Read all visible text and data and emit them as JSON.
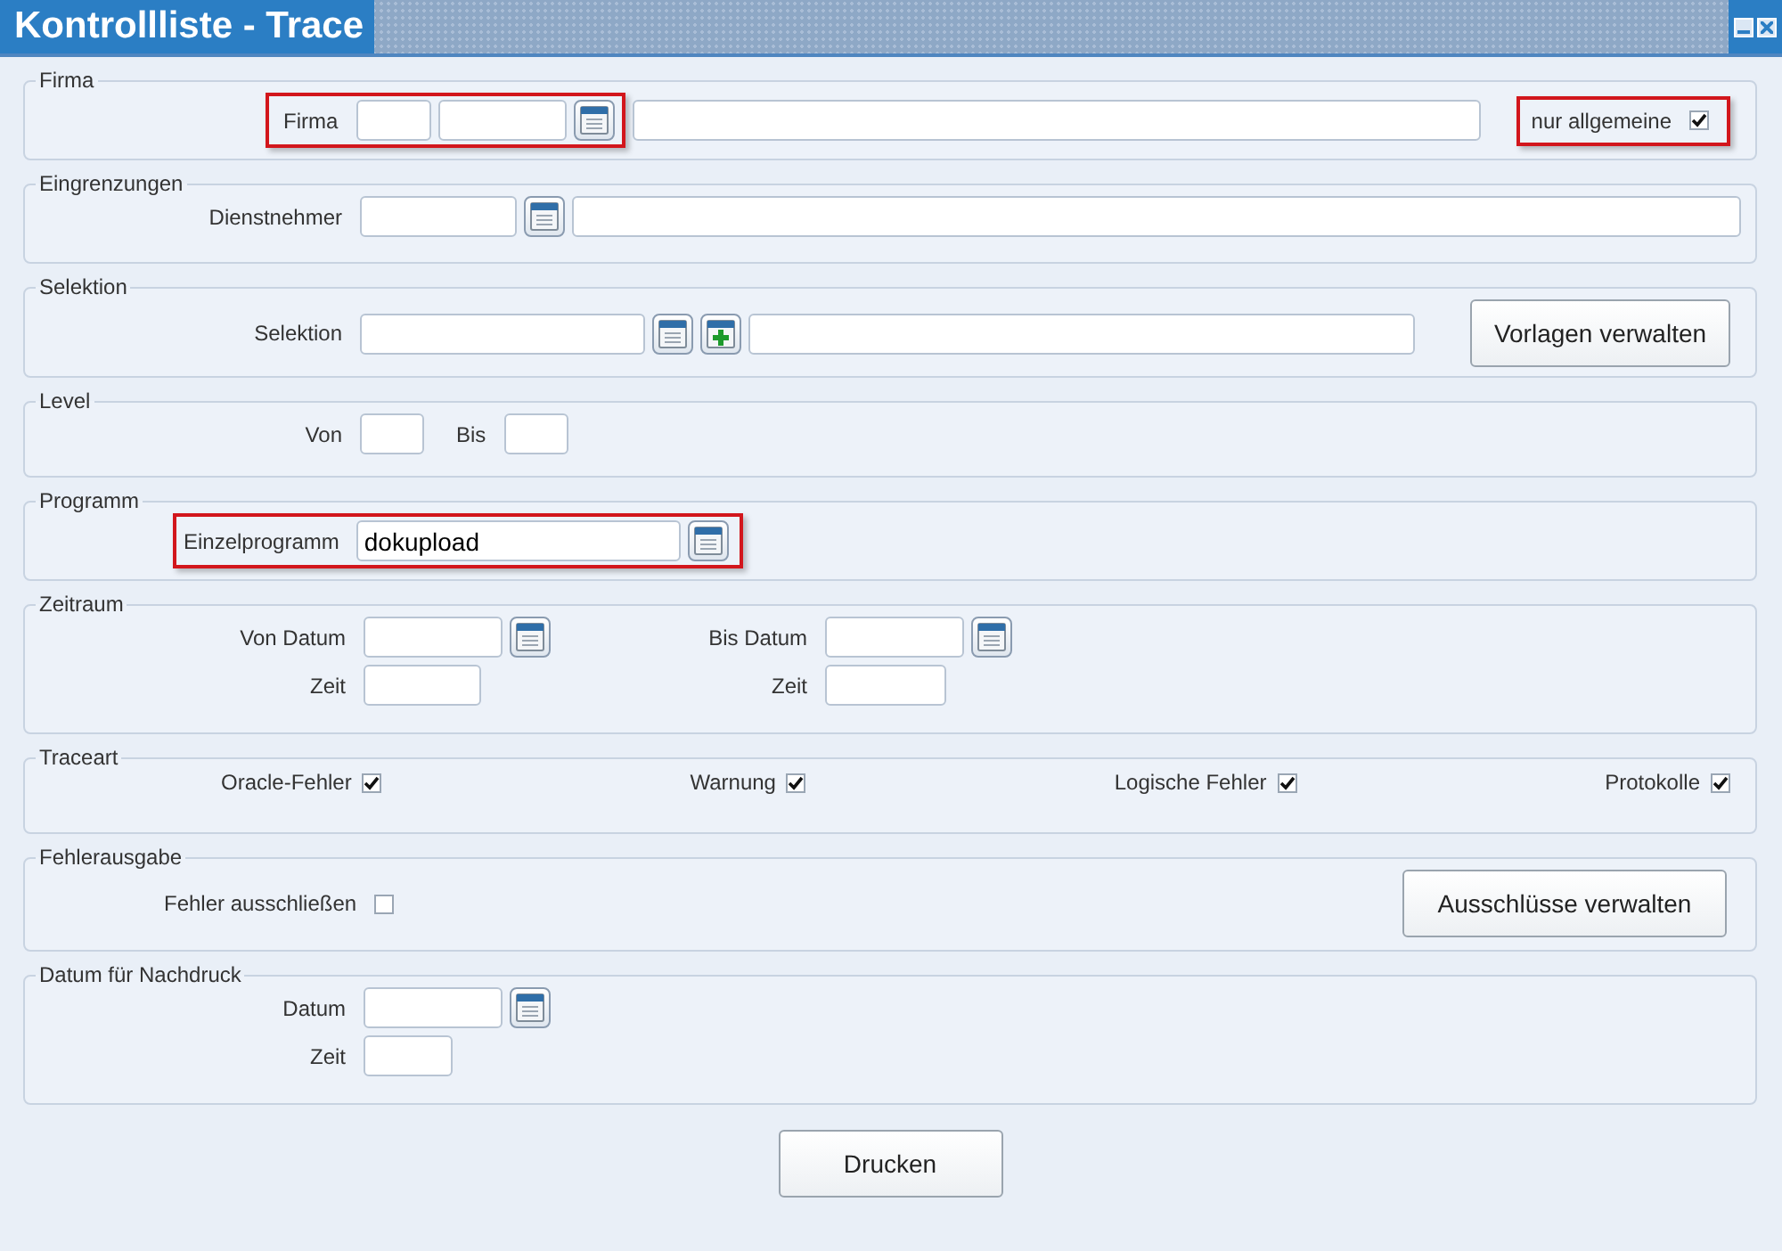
{
  "window": {
    "title": "Kontrollliste - Trace"
  },
  "sections": [
    {
      "kind": "firma",
      "legend": "Firma",
      "label": "Firma",
      "highlighted": true,
      "option_label": "nur allgemeine",
      "option_checked": true,
      "option_highlighted": true
    },
    {
      "kind": "lookup",
      "legend": "Eingrenzungen",
      "label": "Dienstnehmer"
    },
    {
      "kind": "selektion",
      "legend": "Selektion",
      "label": "Selektion",
      "button": "Vorlagen verwalten"
    },
    {
      "kind": "range",
      "legend": "Level",
      "from_label": "Von",
      "to_label": "Bis"
    },
    {
      "kind": "program",
      "legend": "Programm",
      "label": "Einzelprogramm",
      "value": "dokupload",
      "highlighted": true
    },
    {
      "kind": "period",
      "legend": "Zeitraum",
      "from_date": "Von Datum",
      "from_time": "Zeit",
      "to_date": "Bis Datum",
      "to_time": "Zeit"
    },
    {
      "kind": "checks",
      "legend": "Traceart",
      "options": [
        {
          "label": "Oracle-Fehler",
          "checked": true
        },
        {
          "label": "Warnung",
          "checked": true
        },
        {
          "label": "Logische Fehler",
          "checked": true
        },
        {
          "label": "Protokolle",
          "checked": true
        }
      ]
    },
    {
      "kind": "exclusions",
      "legend": "Fehlerausgabe",
      "label": "Fehler ausschließen",
      "checked": false,
      "button": "Ausschlüsse verwalten"
    },
    {
      "kind": "reprint",
      "legend": "Datum für Nachdruck",
      "date_label": "Datum",
      "time_label": "Zeit"
    }
  ],
  "print_button": "Drucken"
}
